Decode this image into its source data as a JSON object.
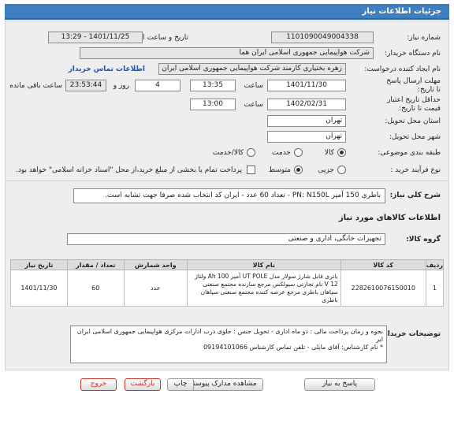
{
  "header": {
    "title": "جزئیات اطلاعات نیاز"
  },
  "need_number": {
    "label": "شماره نیاز:",
    "value": "1101090049004338"
  },
  "announce_datetime": {
    "label": "تاریخ و ساعت اعلان عمومی:",
    "value": "1401/11/25 - 13:29"
  },
  "buyer_org": {
    "label": "نام دستگاه خریدار:",
    "value": "شرکت هواپیمایی جمهوری اسلامی ایران هما"
  },
  "requester": {
    "label": "نام ایجاد کننده درخواست:",
    "value": "زهره بختیاری کارمند شرکت هواپیمایی جمهوری اسلامی ایران هما",
    "contact_link": "اطلاعات تماس خریدار"
  },
  "deadline": {
    "label": "مهلت ارسال پاسخ تا تاریخ:",
    "date": "1401/11/30",
    "time_label": "ساعت",
    "time": "13:35",
    "days": "4",
    "days_label": "روز و",
    "remaining": "23:53:44",
    "remaining_label": "ساعت باقی مانده"
  },
  "validity": {
    "label": "حداقل تاریخ اعتبار قیمت تا تاریخ:",
    "date": "1402/02/31",
    "time_label": "ساعت",
    "time": "13:00"
  },
  "province": {
    "label": "استان محل تحویل:",
    "value": "تهران"
  },
  "city": {
    "label": "شهر محل تحویل:",
    "value": "تهران"
  },
  "category": {
    "label": "طبقه بندی موضوعی:",
    "options": [
      "کالا",
      "خدمت",
      "کالا/خدمت"
    ]
  },
  "process": {
    "label": "نوع فرآیند خرید :",
    "options": [
      "جزیی",
      "متوسط"
    ],
    "payment_note": "پرداخت تمام یا بخشی از مبلغ خرید،از محل \"اسناد خزانه اسلامی\" خواهد بود."
  },
  "general_desc": {
    "label": "شرح کلی نیاز:",
    "value": "باطری 150 آمپر PN: N150L - تعداد 60 عدد - ایران کد انتخاب شده صرفا جهت تشابه است."
  },
  "goods_section": {
    "title": "اطلاعات کالاهای مورد نیاز"
  },
  "goods_group": {
    "label": "گروه کالا:",
    "value": "تجهیزات خانگی، اداری و صنعتی"
  },
  "table": {
    "headers": [
      "ردیف",
      "کد کالا",
      "نام کالا",
      "واحد شمارش",
      "تعداد / مقدار",
      "تاریخ نیاز"
    ],
    "rows": [
      {
        "row": "1",
        "code": "2282610076150010",
        "name": "باتری قابل شارژ سولار مدل UT POLE آمپر 100 Ah ولتاژ 12 V نام تجارتی سیولکس مرجع سازنده مجتمع صنعتی سپاهان باطری مرجع عرضه کننده مجتمع صنعتی سپاهان باطری",
        "unit": "عدد",
        "qty": "60",
        "date": "1401/11/30"
      }
    ]
  },
  "notes": {
    "label": "توضیحات خریدار:",
    "line1": "نحوه و زمان پرداخت مالی : دو ماه اداری - تحویل جنس : جلوی درب ادارات مرکزی هواپیمایی جمهوری اسلامی ایران ایر",
    "line2": "* نام کارشناس: آقای مایلی - تلفن تماس کارشناس 09194101066"
  },
  "buttons": {
    "reply": "پاسخ به نیاز",
    "view_docs": "مشاهده مدارک پیوستی (0)",
    "print": "چاپ",
    "back": "بازگشت",
    "exit": "خروج"
  },
  "colors": {
    "header_bg": "#3f7fbf",
    "link": "#1b52b8",
    "exit_text": "#c0392b"
  }
}
